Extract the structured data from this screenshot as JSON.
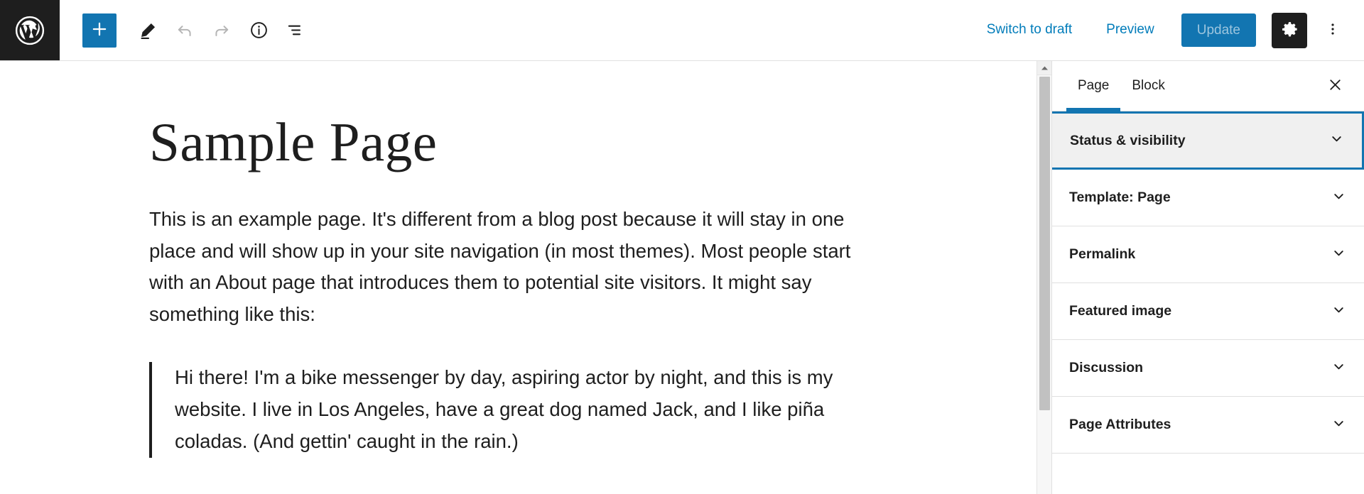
{
  "header": {
    "logo_icon": "wordpress-logo-icon",
    "left_tools": [
      {
        "name": "add-block-button",
        "icon": "plus-icon",
        "label": "Add block",
        "state": "active"
      },
      {
        "name": "edit-mode-button",
        "icon": "pencil-icon",
        "label": "Edit",
        "state": "enabled"
      },
      {
        "name": "undo-button",
        "icon": "undo-arrow-icon",
        "label": "Undo",
        "state": "disabled"
      },
      {
        "name": "redo-button",
        "icon": "redo-arrow-icon",
        "label": "Redo",
        "state": "disabled"
      },
      {
        "name": "details-button",
        "icon": "info-circle-icon",
        "label": "Details",
        "state": "enabled"
      },
      {
        "name": "list-view-button",
        "icon": "list-view-icon",
        "label": "List view",
        "state": "enabled"
      }
    ],
    "switch_to_draft_label": "Switch to draft",
    "preview_label": "Preview",
    "update_label": "Update",
    "settings_icon": "gear-icon",
    "more_menu_icon": "three-dots-vertical-icon"
  },
  "editor": {
    "title": "Sample Page",
    "paragraph": "This is an example page. It's different from a blog post because it will stay in one place and will show up in your site navigation (in most themes). Most people start with an About page that introduces them to potential site visitors. It might say something like this:",
    "quote": "Hi there! I'm a bike messenger by day, aspiring actor by night, and this is my website. I live in Los Angeles, have a great dog named Jack, and I like piña coladas. (And gettin' caught in the rain.)"
  },
  "sidebar": {
    "tabs": [
      {
        "label": "Page",
        "active": true
      },
      {
        "label": "Block",
        "active": false
      }
    ],
    "close_icon": "close-x-icon",
    "panels": [
      {
        "label": "Status & visibility",
        "icon": "chevron-down-icon",
        "focused": true
      },
      {
        "label": "Template: Page",
        "icon": "chevron-down-icon",
        "focused": false
      },
      {
        "label": "Permalink",
        "icon": "chevron-down-icon",
        "focused": false
      },
      {
        "label": "Featured image",
        "icon": "chevron-down-icon",
        "focused": false
      },
      {
        "label": "Discussion",
        "icon": "chevron-down-icon",
        "focused": false
      },
      {
        "label": "Page Attributes",
        "icon": "chevron-down-icon",
        "focused": false
      }
    ]
  },
  "colors": {
    "accent_blue": "#1275b1",
    "link_blue": "#007cba",
    "dark": "#1e1e1e",
    "border": "#e0e0e0",
    "panel_focus_bg": "#f0f0f0"
  }
}
